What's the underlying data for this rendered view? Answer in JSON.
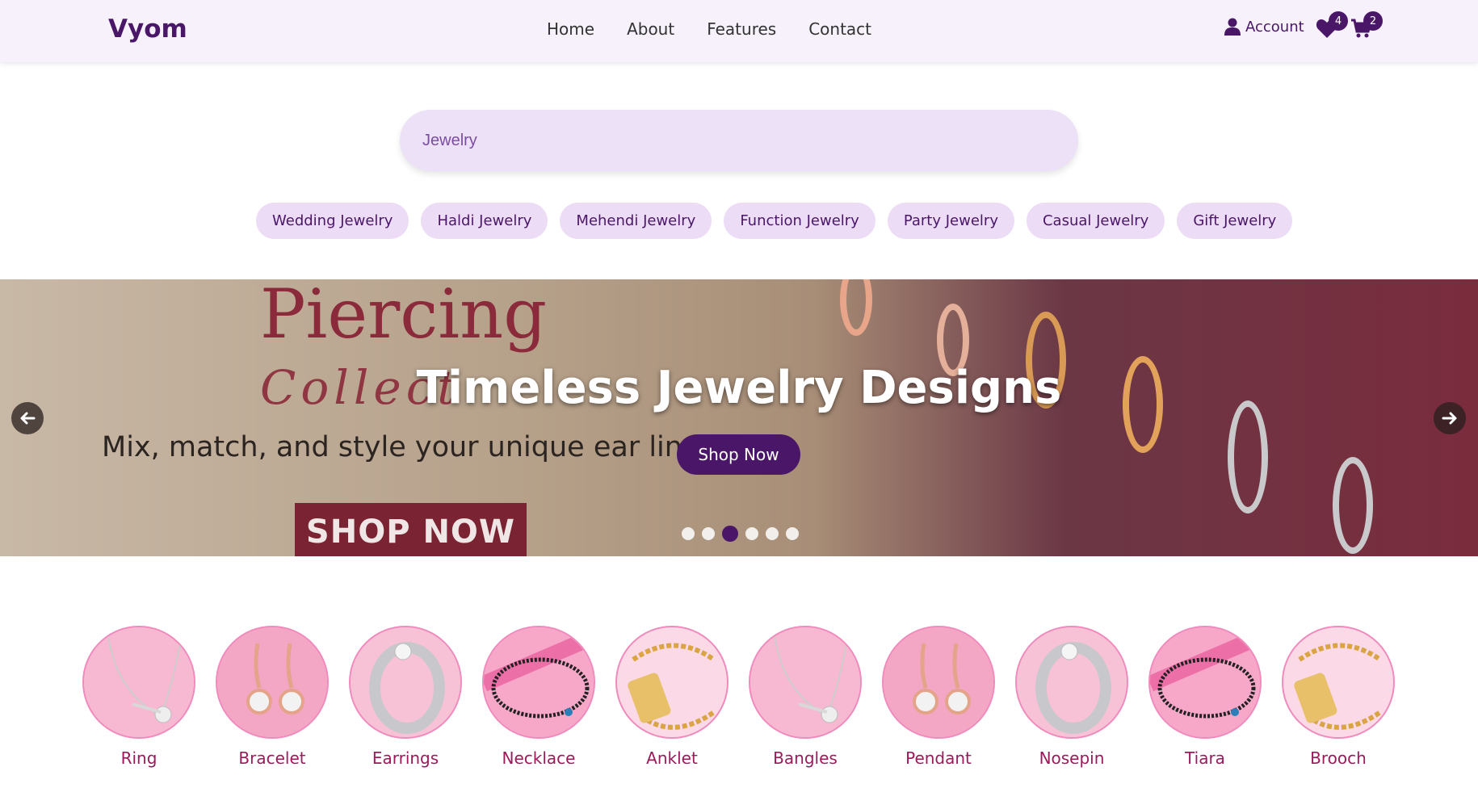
{
  "brand": "Vyom",
  "nav": [
    "Home",
    "About",
    "Features",
    "Contact"
  ],
  "account_label": "Account",
  "wishlist_count": "4",
  "cart_count": "2",
  "search": {
    "value": "Jewelry"
  },
  "chips": [
    "Wedding Jewelry",
    "Haldi Jewelry",
    "Mehendi Jewelry",
    "Function Jewelry",
    "Party Jewelry",
    "Casual Jewelry",
    "Gift Jewelry"
  ],
  "banner": {
    "image_text_1": "Piercing",
    "image_text_2": "Collect",
    "image_text_3": "Mix, match, and style your unique ear line",
    "image_shop": "SHOP NOW",
    "title": "Timeless Jewelry Designs",
    "cta": "Shop Now",
    "slide_count": 6,
    "active_slide": 3
  },
  "categories": [
    "Ring",
    "Bracelet",
    "Earrings",
    "Necklace",
    "Anklet",
    "Bangles",
    "Pendant",
    "Nosepin",
    "Tiara",
    "Brooch"
  ],
  "colors": {
    "brand": "#4a1768",
    "category_text": "#9b1b5a",
    "chip_bg": "#eddcf6",
    "header_bg": "#f6f1fb"
  }
}
